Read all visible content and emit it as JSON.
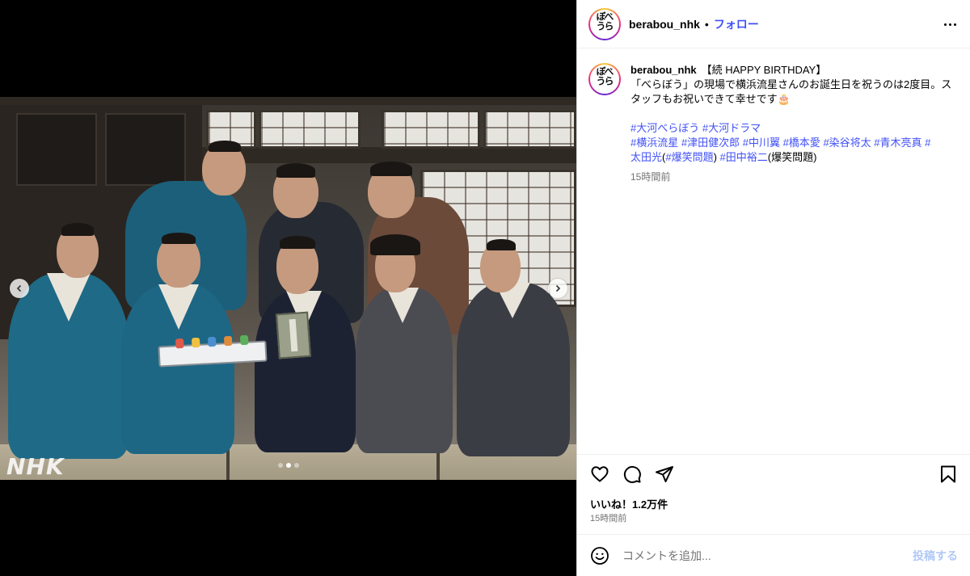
{
  "post": {
    "username": "berabou_nhk",
    "bullet": "•",
    "follow_label": "フォロー",
    "avatar_text": "べらぼう",
    "caption_title": "【続 HAPPY BIRTHDAY】",
    "caption_text": "「べらぼう」の現場で横浜流星さんのお誕生日を祝うのは2度目。スタッフもお祝いできて幸せです🎂",
    "hashtags_line1": [
      {
        "text": "#大河べらぼう"
      },
      {
        "text": "#大河ドラマ"
      }
    ],
    "hashtags_line2": [
      {
        "text": "#横浜流星"
      },
      {
        "text": "#津田健次郎"
      },
      {
        "text": "#中川翼"
      },
      {
        "text": "#橋本愛"
      },
      {
        "text": "#染谷将太"
      },
      {
        "text": "#青木亮真"
      },
      {
        "text": "#"
      }
    ],
    "hashtags_line3": {
      "a": "太田光",
      "b": "(",
      "c": "#爆笑問題",
      "d": ") ",
      "e": "#田中裕二",
      "f": "(爆笑問題)"
    },
    "caption_time": "15時間前",
    "likes": "いいね！1.2万件",
    "post_time": "15時間前"
  },
  "media": {
    "watermark": "NHK",
    "carousel_total": 3,
    "carousel_active": 1
  },
  "comment": {
    "placeholder": "コメントを追加...",
    "post_label": "投稿する"
  },
  "icons": {
    "like": "heart-icon",
    "comment": "comment-icon",
    "share": "send-icon",
    "save": "bookmark-icon",
    "emoji": "emoji-icon",
    "more": "more-icon",
    "prev": "chevron-left-icon",
    "next": "chevron-right-icon"
  },
  "colors": {
    "link": "#4150f7",
    "muted": "#737373",
    "post_disabled": "#b2c9f7"
  }
}
